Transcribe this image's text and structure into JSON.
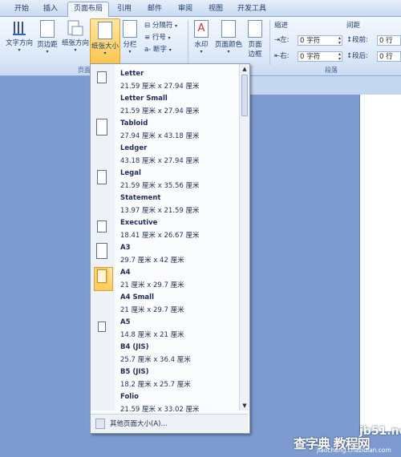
{
  "tabs": [
    "开始",
    "插入",
    "页面布局",
    "引用",
    "邮件",
    "审阅",
    "视图",
    "开发工具"
  ],
  "ribbon": {
    "text_direction": "文字方向",
    "margins": "页边距",
    "orientation": "纸张方向",
    "size": "纸张大小",
    "columns": "分栏",
    "breaks": "分隔符",
    "line_numbers": "行号",
    "hyphenation": "断字",
    "watermark": "水印",
    "page_color": "页面颜色",
    "page_borders_1": "页面",
    "page_borders_2": "边框",
    "group_page_setup": "页面",
    "indent_title": "缩进",
    "indent_left_label": "左:",
    "indent_left_value": "0 字符",
    "indent_right_label": "右:",
    "indent_right_value": "0 字符",
    "spacing_title": "间距",
    "spacing_before_label": "段前:",
    "spacing_before_value": "0 行",
    "spacing_after_label": "段后:",
    "spacing_after_value": "0 行",
    "group_paragraph": "段落"
  },
  "paper_sizes": [
    {
      "name": "Letter",
      "size": "21.59 厘米 x 27.94 厘米"
    },
    {
      "name": "Letter Small",
      "size": "21.59 厘米 x 27.94 厘米"
    },
    {
      "name": "Tabloid",
      "size": "27.94 厘米 x 43.18 厘米"
    },
    {
      "name": "Ledger",
      "size": "43.18 厘米 x 27.94 厘米"
    },
    {
      "name": "Legal",
      "size": "21.59 厘米 x 35.56 厘米"
    },
    {
      "name": "Statement",
      "size": "13.97 厘米 x 21.59 厘米"
    },
    {
      "name": "Executive",
      "size": "18.41 厘米 x 26.67 厘米"
    },
    {
      "name": "A3",
      "size": "29.7 厘米 x 42 厘米"
    },
    {
      "name": "A4",
      "size": "21 厘米 x 29.7 厘米",
      "selected": true
    },
    {
      "name": "A4 Small",
      "size": "21 厘米 x 29.7 厘米"
    },
    {
      "name": "A5",
      "size": "14.8 厘米 x 21 厘米"
    },
    {
      "name": "B4 (JIS)",
      "size": "25.7 厘米 x 36.4 厘米"
    },
    {
      "name": "B5 (JIS)",
      "size": "18.2 厘米 x 25.7 厘米"
    },
    {
      "name": "Folio",
      "size": "21.59 厘米 x 33.02 厘米"
    }
  ],
  "more_sizes": "其他页面大小(A)...",
  "watermark": {
    "site": "jb51.net",
    "brand": "查字典 教程网",
    "url": "jiaocheng.chazidian.com"
  },
  "colors": {
    "accent": "#ffc64c",
    "ribbon": "#dce8f8",
    "background": "#7d9bd0"
  }
}
